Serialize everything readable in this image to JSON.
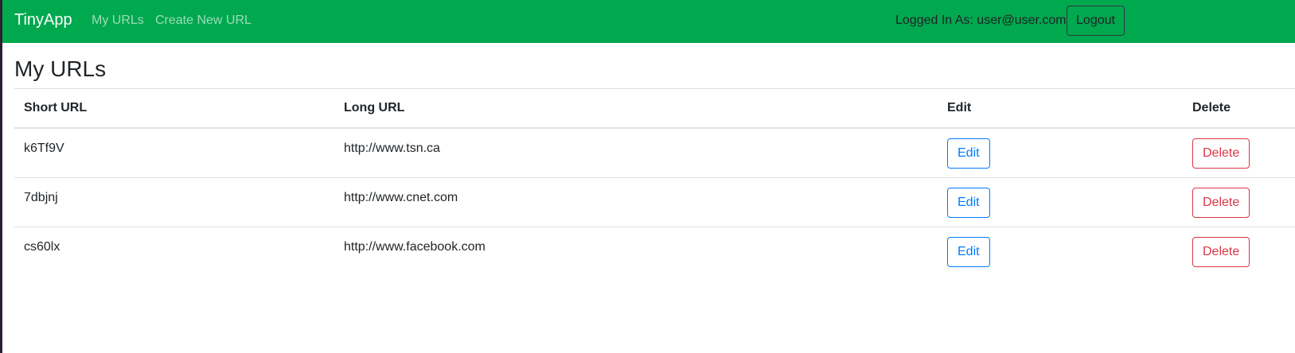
{
  "navbar": {
    "brand": "TinyApp",
    "links": [
      {
        "label": "My URLs"
      },
      {
        "label": "Create New URL"
      }
    ],
    "user_info": "Logged In As: user@user.com",
    "logout_label": "Logout"
  },
  "colors": {
    "navbar_bg": "#00a84e",
    "edit_btn": "#007bff",
    "delete_btn": "#dc3545"
  },
  "page": {
    "title": "My URLs"
  },
  "table": {
    "headers": [
      "Short URL",
      "Long URL",
      "Edit",
      "Delete"
    ],
    "rows": [
      {
        "short": "k6Tf9V",
        "long": "http://www.tsn.ca",
        "edit": "Edit",
        "delete": "Delete"
      },
      {
        "short": "7dbjnj",
        "long": "http://www.cnet.com",
        "edit": "Edit",
        "delete": "Delete"
      },
      {
        "short": "cs60lx",
        "long": "http://www.facebook.com",
        "edit": "Edit",
        "delete": "Delete"
      }
    ]
  }
}
